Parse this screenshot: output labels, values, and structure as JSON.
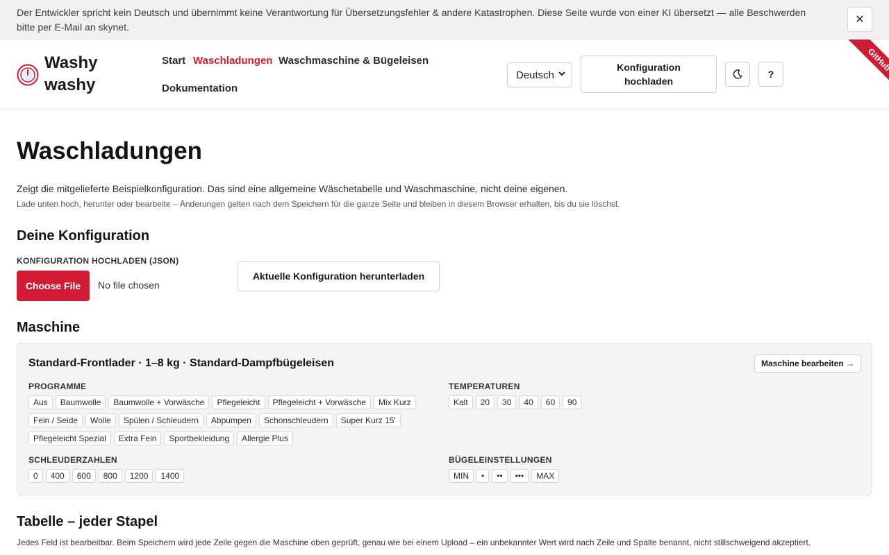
{
  "banner": {
    "text": "Der Entwickler spricht kein Deutsch und übernimmt keine Verantwortung für Übersetzungsfehler & andere Katastrophen. Diese Seite wurde von einer KI übersetzt — alle Beschwerden bitte per E-Mail an skynet.",
    "close_label": "✕"
  },
  "header": {
    "logo_line1": "Washy",
    "logo_line2": "washy",
    "nav": {
      "start": "Start",
      "waschladungen": "Waschladungen",
      "maschine": "Waschmaschine & Bügeleisen",
      "doku": "Dokumentation"
    },
    "language": "Deutsch",
    "upload_line1": "Konfiguration",
    "upload_line2": "hochladen",
    "help_label": "?",
    "github_ribbon": "GitHub"
  },
  "page": {
    "title": "Waschladungen",
    "intro": "Zeigt die mitgelieferte Beispielkonfiguration. Das sind eine allgemeine Wäschetabelle und Waschmaschine, nicht deine eigenen.",
    "intro_small": "Lade unten hoch, herunter oder bearbeite – Änderungen gelten nach dem Speichern für die ganze Seite und bleiben in diesem Browser erhalten, bis du sie löschst."
  },
  "config": {
    "heading": "Deine Konfiguration",
    "upload_label": "KONFIGURATION HOCHLADEN (JSON)",
    "choose_file": "Choose File",
    "no_file": "No file chosen",
    "download": "Aktuelle Konfiguration herunterladen"
  },
  "machine": {
    "heading": "Maschine",
    "title": "Standard-Frontlader · 1–8 kg · Standard-Dampfbügeleisen",
    "edit": "Maschine bearbeiten →",
    "programs_label": "PROGRAMME",
    "programs": [
      "Aus",
      "Baumwolle",
      "Baumwolle + Vorwäsche",
      "Pflegeleicht",
      "Pflegeleicht + Vorwäsche",
      "Mix Kurz",
      "Fein / Seide",
      "Wolle",
      "Spülen / Schleudern",
      "Abpumpen",
      "Schonschleudern",
      "Super Kurz 15'",
      "Pflegeleicht Spezial",
      "Extra Fein",
      "Sportbekleidung",
      "Allergie Plus"
    ],
    "temps_label": "TEMPERATUREN",
    "temps": [
      "Kalt",
      "20",
      "30",
      "40",
      "60",
      "90"
    ],
    "spins_label": "SCHLEUDERZAHLEN",
    "spins": [
      "0",
      "400",
      "600",
      "800",
      "1200",
      "1400"
    ],
    "iron_label": "BÜGELEINSTELLUNGEN",
    "iron": [
      "MIN",
      "•",
      "••",
      "•••",
      "MAX"
    ]
  },
  "table": {
    "heading": "Tabelle – jeder Stapel",
    "text": "Jedes Feld ist bearbeitbar. Beim Speichern wird jede Zeile gegen die Maschine oben geprüft, genau wie bei einem Upload – ein unbekannter Wert wird nach Zeile und Spalte benannt, nicht stillschweigend akzeptiert."
  }
}
